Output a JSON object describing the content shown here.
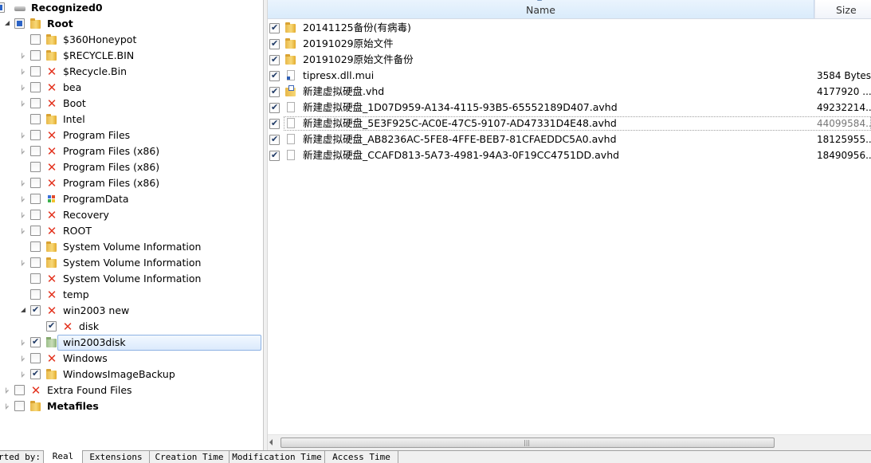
{
  "tree": {
    "items": [
      {
        "label": "Recognized0",
        "bold": true,
        "icon": "disk-drive-icon",
        "checkbox": "partial",
        "expander": "none",
        "level": 0
      },
      {
        "label": "Root",
        "bold": true,
        "icon": "folder-icon",
        "checkbox": "partial",
        "expander": "expanded",
        "level": 1
      },
      {
        "label": "$360Honeypot",
        "icon": "folder-icon",
        "checkbox": "unchecked",
        "expander": "none",
        "level": 2
      },
      {
        "label": "$RECYCLE.BIN",
        "icon": "folder-icon",
        "checkbox": "unchecked",
        "expander": "collapsed",
        "level": 2
      },
      {
        "label": "$Recycle.Bin",
        "icon": "deleted-x-icon",
        "checkbox": "unchecked",
        "expander": "collapsed",
        "level": 2
      },
      {
        "label": "bea",
        "icon": "deleted-x-icon",
        "checkbox": "unchecked",
        "expander": "collapsed",
        "level": 2
      },
      {
        "label": "Boot",
        "icon": "deleted-x-icon",
        "checkbox": "unchecked",
        "expander": "collapsed",
        "level": 2
      },
      {
        "label": "Intel",
        "icon": "folder-icon",
        "checkbox": "unchecked",
        "expander": "none",
        "level": 2
      },
      {
        "label": "Program Files",
        "icon": "deleted-x-icon",
        "checkbox": "unchecked",
        "expander": "collapsed",
        "level": 2
      },
      {
        "label": "Program Files (x86)",
        "icon": "deleted-x-icon",
        "checkbox": "unchecked",
        "expander": "collapsed",
        "level": 2
      },
      {
        "label": "Program Files (x86)",
        "icon": "deleted-x-icon",
        "checkbox": "unchecked",
        "expander": "none",
        "level": 2
      },
      {
        "label": "Program Files (x86)",
        "icon": "deleted-x-icon",
        "checkbox": "unchecked",
        "expander": "collapsed",
        "level": 2
      },
      {
        "label": "ProgramData",
        "icon": "program-data-icon",
        "checkbox": "unchecked",
        "expander": "collapsed",
        "level": 2
      },
      {
        "label": "Recovery",
        "icon": "deleted-x-icon",
        "checkbox": "unchecked",
        "expander": "collapsed",
        "level": 2
      },
      {
        "label": "ROOT",
        "icon": "deleted-x-icon",
        "checkbox": "unchecked",
        "expander": "collapsed",
        "level": 2
      },
      {
        "label": "System Volume Information",
        "icon": "folder-icon",
        "checkbox": "unchecked",
        "expander": "none",
        "level": 2
      },
      {
        "label": "System Volume Information",
        "icon": "folder-icon",
        "checkbox": "unchecked",
        "expander": "collapsed",
        "level": 2
      },
      {
        "label": "System Volume Information",
        "icon": "deleted-x-icon",
        "checkbox": "unchecked",
        "expander": "none",
        "level": 2
      },
      {
        "label": "temp",
        "icon": "deleted-x-icon",
        "checkbox": "unchecked",
        "expander": "none",
        "level": 2
      },
      {
        "label": "win2003 new",
        "icon": "deleted-x-icon",
        "checkbox": "checked",
        "expander": "expanded",
        "level": 2
      },
      {
        "label": "disk",
        "icon": "deleted-x-icon",
        "checkbox": "checked",
        "expander": "none",
        "level": 3
      },
      {
        "label": "win2003disk",
        "icon": "folder-green-icon",
        "checkbox": "checked",
        "expander": "collapsed",
        "level": 2,
        "selected": true
      },
      {
        "label": "Windows",
        "icon": "deleted-x-icon",
        "checkbox": "unchecked",
        "expander": "collapsed",
        "level": 2
      },
      {
        "label": "WindowsImageBackup",
        "icon": "folder-icon",
        "checkbox": "checked",
        "expander": "collapsed",
        "level": 2
      },
      {
        "label": "Extra Found Files",
        "icon": "deleted-x-icon",
        "checkbox": "unchecked",
        "expander": "collapsed",
        "level": 1
      },
      {
        "label": "Metafiles",
        "bold": true,
        "icon": "folder-icon",
        "checkbox": "unchecked",
        "expander": "collapsed",
        "level": 1
      }
    ]
  },
  "list": {
    "columns": {
      "name": "Name",
      "size": "Size"
    },
    "rows": [
      {
        "name": "20141125备份(有病毒)",
        "size": "",
        "icon": "folder-icon",
        "checked": true
      },
      {
        "name": "20191029原始文件",
        "size": "",
        "icon": "folder-icon",
        "checked": true
      },
      {
        "name": "20191029原始文件备份",
        "size": "",
        "icon": "folder-icon",
        "checked": true
      },
      {
        "name": "tipresx.dll.mui",
        "size": "3584 Bytes",
        "icon": "dll-file-icon",
        "checked": true
      },
      {
        "name": "新建虚拟硬盘.vhd",
        "size": "4177920 ...",
        "icon": "vhd-file-icon",
        "checked": true
      },
      {
        "name": "新建虚拟硬盘_1D07D959-A134-4115-93B5-65552189D407.avhd",
        "size": "49232214...",
        "icon": "file-icon",
        "checked": true
      },
      {
        "name": "新建虚拟硬盘_5E3F925C-AC0E-47C5-9107-AD47331D4E48.avhd",
        "size": "44099584...",
        "icon": "file-icon",
        "checked": true,
        "focused": true
      },
      {
        "name": "新建虚拟硬盘_AB8236AC-5FE8-4FFE-BEB7-81CFAEDDC5A0.avhd",
        "size": "18125955...",
        "icon": "file-icon",
        "checked": true
      },
      {
        "name": "新建虚拟硬盘_CCAFD813-5A73-4981-94A3-0F19CC4751DD.avhd",
        "size": "18490956...",
        "icon": "file-icon",
        "checked": true
      }
    ]
  },
  "tabbar": {
    "sorted_label": "rted by:",
    "tabs": [
      {
        "label": "Real",
        "active": true
      },
      {
        "label": "Extensions"
      },
      {
        "label": "Creation Time"
      },
      {
        "label": "Modification Time"
      },
      {
        "label": "Access Time"
      }
    ]
  },
  "colors": {
    "accent": "#2b63c6",
    "deleted": "#e3331f",
    "folder": "#f2c94c",
    "selection_border": "#8db2e3"
  }
}
